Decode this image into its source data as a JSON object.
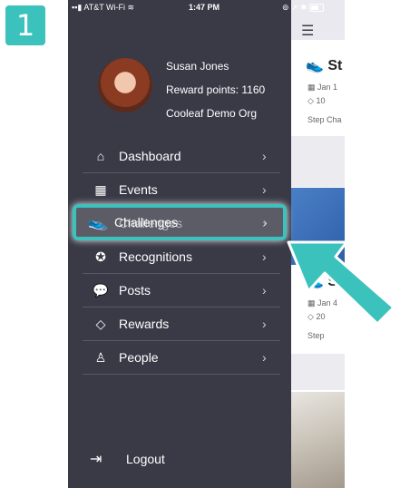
{
  "step": {
    "number": "1"
  },
  "status_bar": {
    "carrier": "AT&T Wi-Fi",
    "time": "1:47 PM"
  },
  "profile": {
    "name": "Susan Jones",
    "points": "Reward points: 1160",
    "org": "Cooleaf Demo Org"
  },
  "menu": {
    "items": [
      {
        "label": "Dashboard",
        "icon": "home-icon"
      },
      {
        "label": "Events",
        "icon": "calendar-icon"
      },
      {
        "label": "Challenges",
        "icon": "sneaker-icon"
      },
      {
        "label": "Recognitions",
        "icon": "award-icon"
      },
      {
        "label": "Posts",
        "icon": "chat-icon"
      },
      {
        "label": "Rewards",
        "icon": "diamond-icon"
      },
      {
        "label": "People",
        "icon": "person-icon"
      }
    ],
    "logout": "Logout"
  },
  "content": {
    "card1": {
      "title": "St",
      "date": "Jan 1",
      "points": "10",
      "type": "Step Cha"
    },
    "card2": {
      "title": "St",
      "date": "Jan 4",
      "points": "20",
      "type": "Step"
    }
  },
  "colors": {
    "accent": "#3cc2bd",
    "drawer": "#3a3a47"
  }
}
